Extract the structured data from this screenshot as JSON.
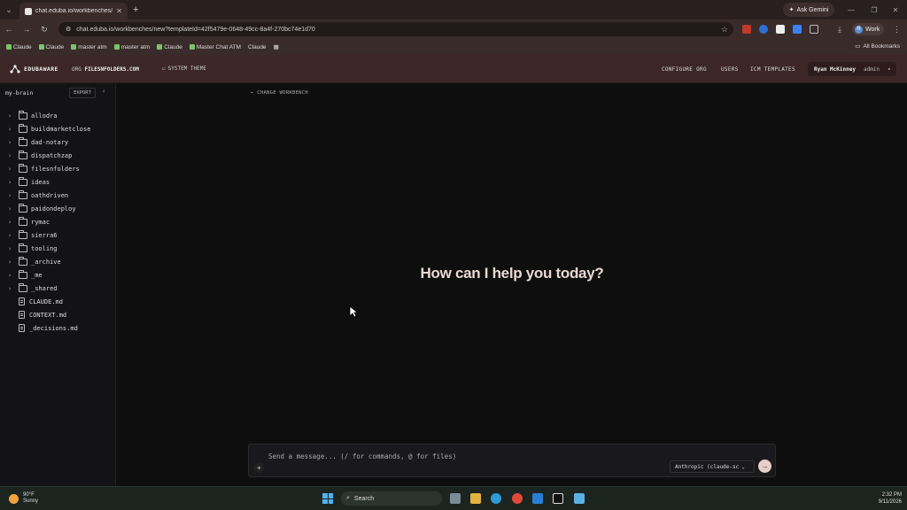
{
  "browser": {
    "tab_title": "chat.eduba.io/workbenches/ne",
    "url": "chat.eduba.io/workbenches/new?templateId=42f5479e-0648-49cc-8a4f-270bc74e1d70",
    "ask_gemini": "Ask Gemini",
    "profile_label": "Work",
    "profile_initial": "R",
    "bookmarks": [
      "Claude",
      "Claude",
      "master atm",
      "master atm",
      "Claude",
      "Master Chat ATM",
      "Claude"
    ],
    "all_bookmarks": "All Bookmarks"
  },
  "header": {
    "brand": "EDUBAWARE",
    "org_prefix": "ORG",
    "org_name": "FILESNFOLDERS.COM",
    "system_theme": "SYSTEM THEME",
    "links": [
      "CONFIGURE ORG",
      "USERS",
      "ICM TEMPLATES"
    ],
    "user_name": "Ryan McKinney",
    "user_role": "admin"
  },
  "sidebar": {
    "title": "my-brain",
    "export_label": "EXPORT",
    "folders": [
      "allodra",
      "buildmarketclose",
      "dad-notary",
      "dispatchzap",
      "filesnfolders",
      "ideas",
      "oathdriven",
      "paidondeploy",
      "rymac",
      "sierra6",
      "tooling",
      "_archive",
      "_me",
      "_shared"
    ],
    "files": [
      "CLAUDE.md",
      "CONTEXT.md",
      "_decisions.md"
    ]
  },
  "main": {
    "change_workbench": "CHANGE WORKBENCH",
    "greeting": "How can I help you today?",
    "composer_placeholder": "Send a message... (/ for commands, @ for files)",
    "model_label": "Anthropic (claude-sc"
  },
  "taskbar": {
    "weather_temp": "90°F",
    "weather_desc": "Sunny",
    "search_label": "Search",
    "time": "2:32 PM",
    "date": "9/11/2026"
  }
}
